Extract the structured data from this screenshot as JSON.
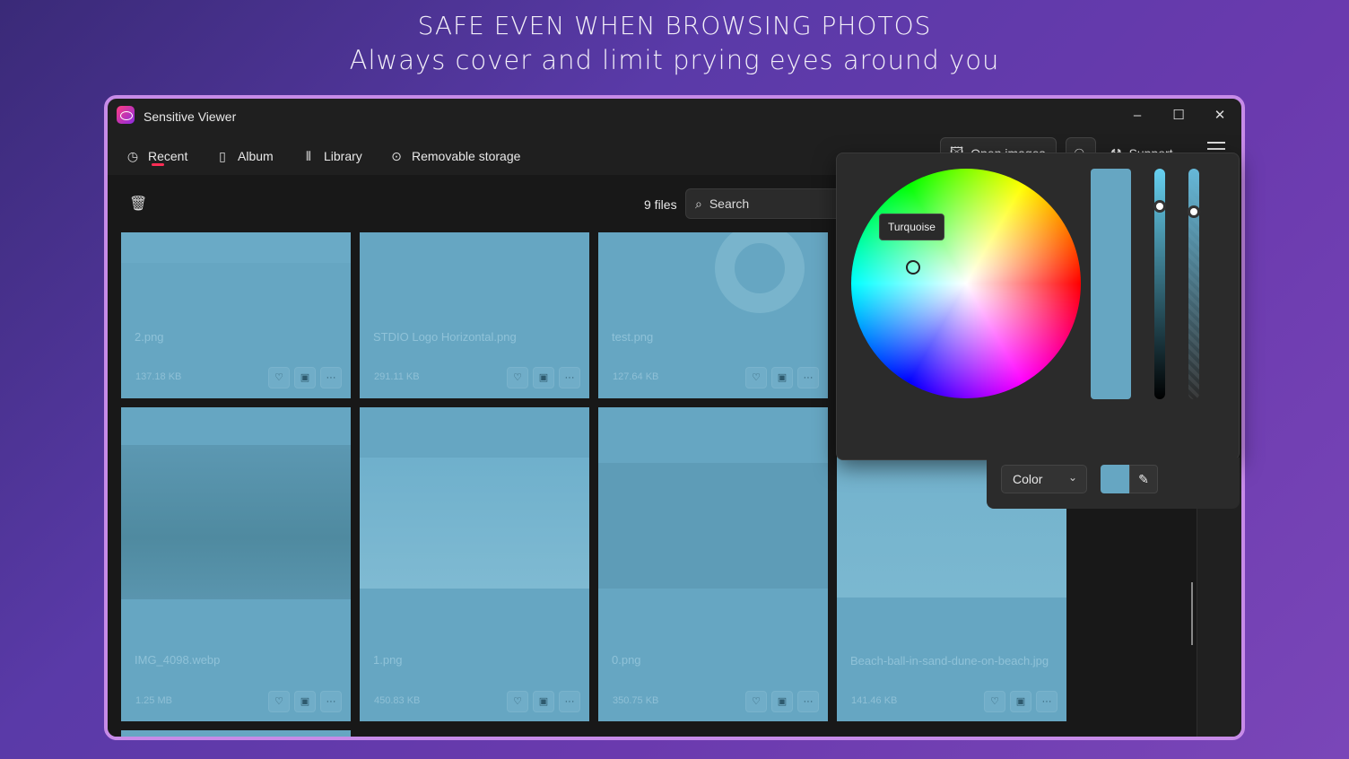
{
  "promo": {
    "headline": "SAFE EVEN WHEN BROWSING PHOTOS",
    "tagline": "Always cover and limit prying eyes around you"
  },
  "window": {
    "title": "Sensitive Viewer",
    "controls": {
      "minimize": "–",
      "maximize": "☐",
      "close": "✕"
    }
  },
  "nav": {
    "items": [
      {
        "label": "Recent",
        "icon": "clock-icon"
      },
      {
        "label": "Album",
        "icon": "album-icon"
      },
      {
        "label": "Library",
        "icon": "library-icon"
      },
      {
        "label": "Removable storage",
        "icon": "drive-icon"
      }
    ],
    "active": "Recent",
    "open_images": "Open images",
    "support": "Support"
  },
  "toolbar": {
    "file_count": "9 files",
    "search_placeholder": "Search"
  },
  "files": [
    {
      "name": "2.png",
      "size": "137.18 KB"
    },
    {
      "name": "STDIO Logo Horizontal.png",
      "size": "291.11 KB"
    },
    {
      "name": "test.png",
      "size": "127.64 KB"
    },
    {
      "name": "IMG_4098.webp",
      "size": "1.25 MB"
    },
    {
      "name": "1.png",
      "size": "450.83 KB"
    },
    {
      "name": "0.png",
      "size": "350.75 KB"
    },
    {
      "name": "Beach-ball-in-sand-dune-on-beach.jpg",
      "size": "141.46 KB"
    }
  ],
  "picker": {
    "tooltip": "Turquoise",
    "selected_color": "#66a6c2",
    "mode_label": "Color"
  },
  "colors": {
    "accent": "#ff2d55",
    "overlay": "#66a6c2",
    "window_border": "#c78be8"
  }
}
